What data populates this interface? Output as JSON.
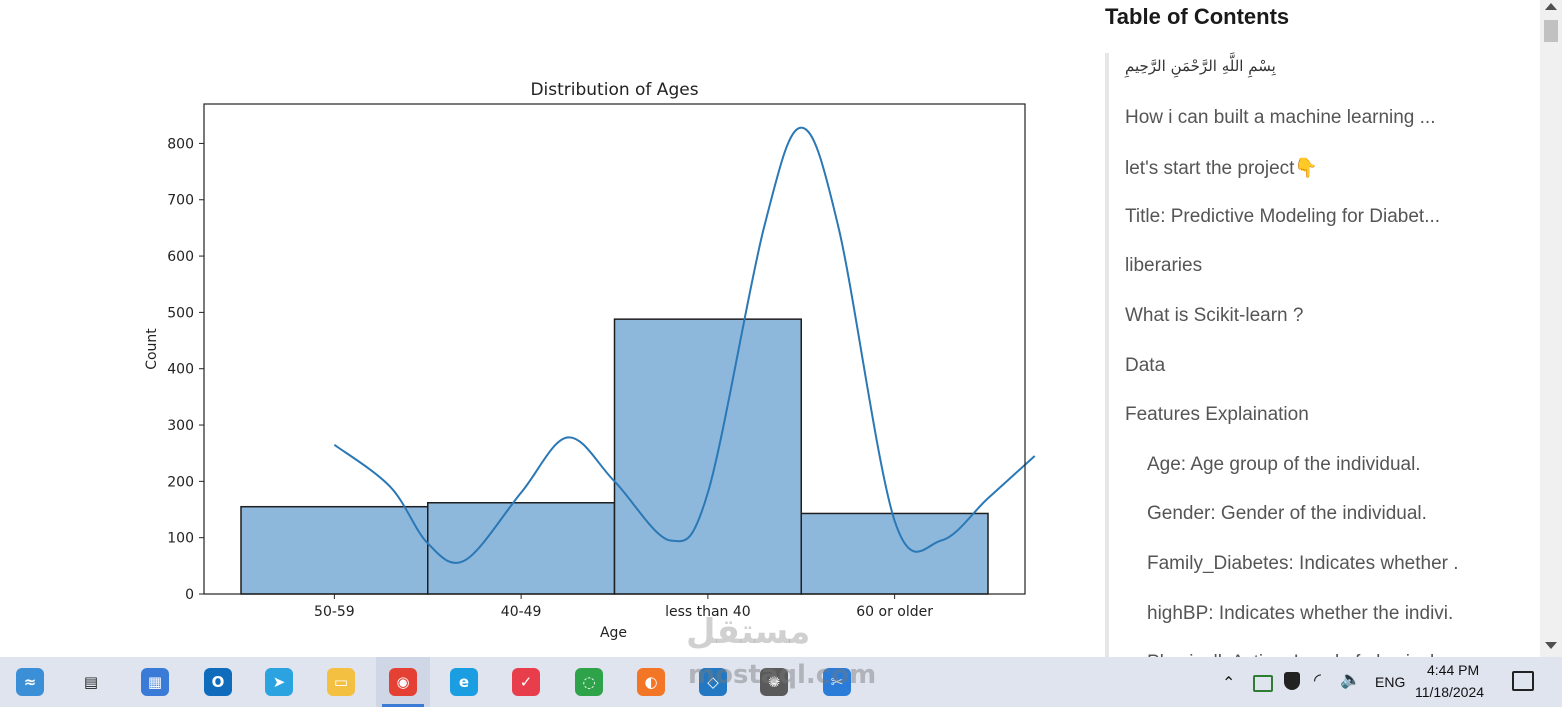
{
  "chart_data": {
    "type": "bar",
    "title": "Distribution of Ages",
    "xlabel": "Age",
    "ylabel": "Count",
    "categories": [
      "50-59",
      "40-49",
      "less than 40",
      "60 or older"
    ],
    "values": [
      155,
      162,
      488,
      143
    ],
    "kde": [
      {
        "x": 0.0,
        "y": 265
      },
      {
        "x": 0.3,
        "y": 190
      },
      {
        "x": 0.5,
        "y": 90
      },
      {
        "x": 0.7,
        "y": 60
      },
      {
        "x": 1.0,
        "y": 180
      },
      {
        "x": 1.25,
        "y": 278
      },
      {
        "x": 1.5,
        "y": 200
      },
      {
        "x": 1.8,
        "y": 95
      },
      {
        "x": 2.0,
        "y": 180
      },
      {
        "x": 2.3,
        "y": 650
      },
      {
        "x": 2.5,
        "y": 828
      },
      {
        "x": 2.7,
        "y": 650
      },
      {
        "x": 3.0,
        "y": 130
      },
      {
        "x": 3.25,
        "y": 95
      },
      {
        "x": 3.5,
        "y": 170
      },
      {
        "x": 3.75,
        "y": 245
      }
    ],
    "ylim": [
      0,
      870
    ],
    "yticks": [
      0,
      100,
      200,
      300,
      400,
      500,
      600,
      700,
      800
    ],
    "colors": {
      "bar": "#8db8dc",
      "bar_edge": "#1f1f1f",
      "kde": "#2a78b5"
    }
  },
  "toc": {
    "title": "Table of Contents",
    "items": [
      {
        "label": "بِسْمِ اللَّهِ الرَّحْمَنِ الرَّحِيمِ",
        "indent": false,
        "arabic": true
      },
      {
        "label": "How i can built a machine learning ...",
        "indent": false
      },
      {
        "label": "let's start the project👇",
        "indent": false
      },
      {
        "label": "Title: Predictive Modeling for Diabet...",
        "indent": false
      },
      {
        "label": "liberaries",
        "indent": false
      },
      {
        "label": "What is Scikit-learn ?",
        "indent": false
      },
      {
        "label": "Data",
        "indent": false
      },
      {
        "label": "Features Explaination",
        "indent": false
      },
      {
        "label": "Age: Age group of the individual.",
        "indent": true
      },
      {
        "label": "Gender: Gender of the individual.",
        "indent": true
      },
      {
        "label": "Family_Diabetes: Indicates whether .",
        "indent": true
      },
      {
        "label": "highBP: Indicates whether the indivi.",
        "indent": true
      },
      {
        "label": "PhysicallyActive: Level of physical a",
        "indent": true
      }
    ]
  },
  "watermark": {
    "top": "مستقل",
    "bottom": "mostaql.com"
  },
  "taskbar": {
    "apps": [
      {
        "name": "widgets",
        "icon": "weather-wave-icon",
        "color": "#3b8fd6"
      },
      {
        "name": "task-view",
        "icon": "task-view-icon",
        "color": "#333333"
      },
      {
        "name": "store",
        "icon": "store-icon",
        "color": "#3b7bd8"
      },
      {
        "name": "outlook",
        "icon": "outlook-icon",
        "color": "#0f6cbd"
      },
      {
        "name": "telegram",
        "icon": "telegram-icon",
        "color": "#2aa3e0"
      },
      {
        "name": "file-explorer",
        "icon": "folder-icon",
        "color": "#f4c042"
      },
      {
        "name": "chrome",
        "icon": "chrome-icon",
        "color": "#e44134"
      },
      {
        "name": "edge",
        "icon": "edge-icon",
        "color": "#1b9de2"
      },
      {
        "name": "calendar-app",
        "icon": "calendar-icon",
        "color": "#e83e4b"
      },
      {
        "name": "sync-app",
        "icon": "ring-icon",
        "color": "#2fa34a"
      },
      {
        "name": "jupyter",
        "icon": "jupyter-icon",
        "color": "#f37626"
      },
      {
        "name": "vscode",
        "icon": "vscode-icon",
        "color": "#2378c4"
      },
      {
        "name": "chatgpt",
        "icon": "chatgpt-icon",
        "color": "#5a5a5a"
      },
      {
        "name": "snipping-tool",
        "icon": "scissors-icon",
        "color": "#2b7cd8"
      }
    ],
    "tray": {
      "lang": "ENG",
      "time": "4:44 PM",
      "date": "11/18/2024"
    }
  }
}
